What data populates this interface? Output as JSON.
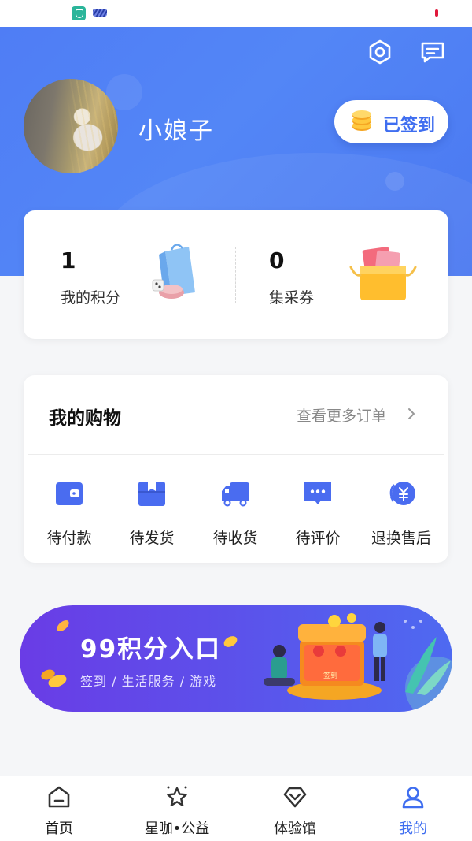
{
  "profile": {
    "username": "小娘子",
    "signin_label": "已签到"
  },
  "points_card": {
    "points_value": "1",
    "points_label": "我的积分",
    "coupons_value": "0",
    "coupons_label": "集采券"
  },
  "shopping": {
    "title": "我的购物",
    "more_orders": "查看更多订单",
    "orders": [
      {
        "label": "待付款",
        "icon": "wallet-icon"
      },
      {
        "label": "待发货",
        "icon": "package-icon"
      },
      {
        "label": "待收货",
        "icon": "truck-icon"
      },
      {
        "label": "待评价",
        "icon": "comment-icon"
      },
      {
        "label": "退换售后",
        "icon": "refund-icon"
      }
    ]
  },
  "banner": {
    "title": "99积分入口",
    "subtitle": "签到 / 生活服务 / 游戏",
    "chest_text": "签到"
  },
  "bottom_nav": {
    "items": [
      {
        "label": "首页",
        "icon": "home-icon"
      },
      {
        "label": "星咖•公益",
        "icon": "star-icon"
      },
      {
        "label": "体验馆",
        "icon": "diamond-icon"
      },
      {
        "label": "我的",
        "icon": "user-icon"
      }
    ],
    "active_index": 3
  },
  "colors": {
    "brand_blue": "#4f7df5",
    "accent_blue": "#3f6ef0",
    "order_icon_blue": "#4a6cf0",
    "banner_purple": "#6a3ce6"
  }
}
